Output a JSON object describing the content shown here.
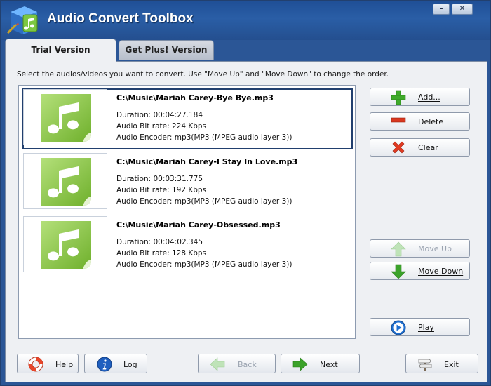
{
  "window": {
    "title": "Audio Convert Toolbox",
    "minimize_glyph": "–",
    "close_glyph": "✕",
    "app_icon": "music-cube-icon"
  },
  "tabs": [
    {
      "label": "Trial Version",
      "active": true
    },
    {
      "label": "Get Plus! Version",
      "active": false
    }
  ],
  "instruction": "Select the audios/videos you want to convert. Use \"Move Up\" and \"Move Down\" to change the order.",
  "files": [
    {
      "path": "C:\\Music\\Mariah Carey-Bye Bye.mp3",
      "duration": "Duration: 00:04:27.184",
      "bitrate": "Audio Bit rate: 224 Kbps",
      "encoder": "Audio Encoder: mp3(MP3 (MPEG audio layer 3))",
      "selected": true,
      "icon": "music-note-icon"
    },
    {
      "path": "C:\\Music\\Mariah Carey-I Stay In Love.mp3",
      "duration": "Duration: 00:03:31.775",
      "bitrate": "Audio Bit rate: 192 Kbps",
      "encoder": "Audio Encoder: mp3(MP3 (MPEG audio layer 3))",
      "selected": false,
      "icon": "music-note-icon"
    },
    {
      "path": "C:\\Music\\Mariah Carey-Obsessed.mp3",
      "duration": "Duration: 00:04:02.345",
      "bitrate": "Audio Bit rate: 128 Kbps",
      "encoder": "Audio Encoder: mp3(MP3 (MPEG audio layer 3))",
      "selected": false,
      "icon": "music-note-icon"
    }
  ],
  "side_buttons": {
    "add": {
      "label": "Add...",
      "icon": "plus-icon",
      "enabled": true
    },
    "delete": {
      "label": "Delete",
      "icon": "minus-icon",
      "enabled": true
    },
    "clear": {
      "label": "Clear",
      "icon": "x-icon",
      "enabled": true
    },
    "move_up": {
      "label": "Move Up",
      "icon": "arrow-up-icon",
      "enabled": false
    },
    "move_down": {
      "label": "Move Down",
      "icon": "arrow-down-icon",
      "enabled": true
    },
    "play": {
      "label": "Play",
      "icon": "play-icon",
      "enabled": true
    }
  },
  "bottom_buttons": {
    "help": {
      "label": "Help",
      "icon": "lifebuoy-icon",
      "enabled": true
    },
    "log": {
      "label": "Log",
      "icon": "info-icon",
      "enabled": true
    },
    "back": {
      "label": "Back",
      "icon": "arrow-left-icon",
      "enabled": false
    },
    "next": {
      "label": "Next",
      "icon": "arrow-right-icon",
      "enabled": true
    },
    "exit": {
      "label": "Exit",
      "icon": "signpost-icon",
      "enabled": true
    }
  },
  "colors": {
    "titlebar": "#2a5ea6",
    "panel": "#eef0f3",
    "selection_border": "#213f6e",
    "note_green": "#8cc63f",
    "add_green": "#3faa2a",
    "delete_red": "#d9371f",
    "play_blue": "#1f6fd0"
  }
}
